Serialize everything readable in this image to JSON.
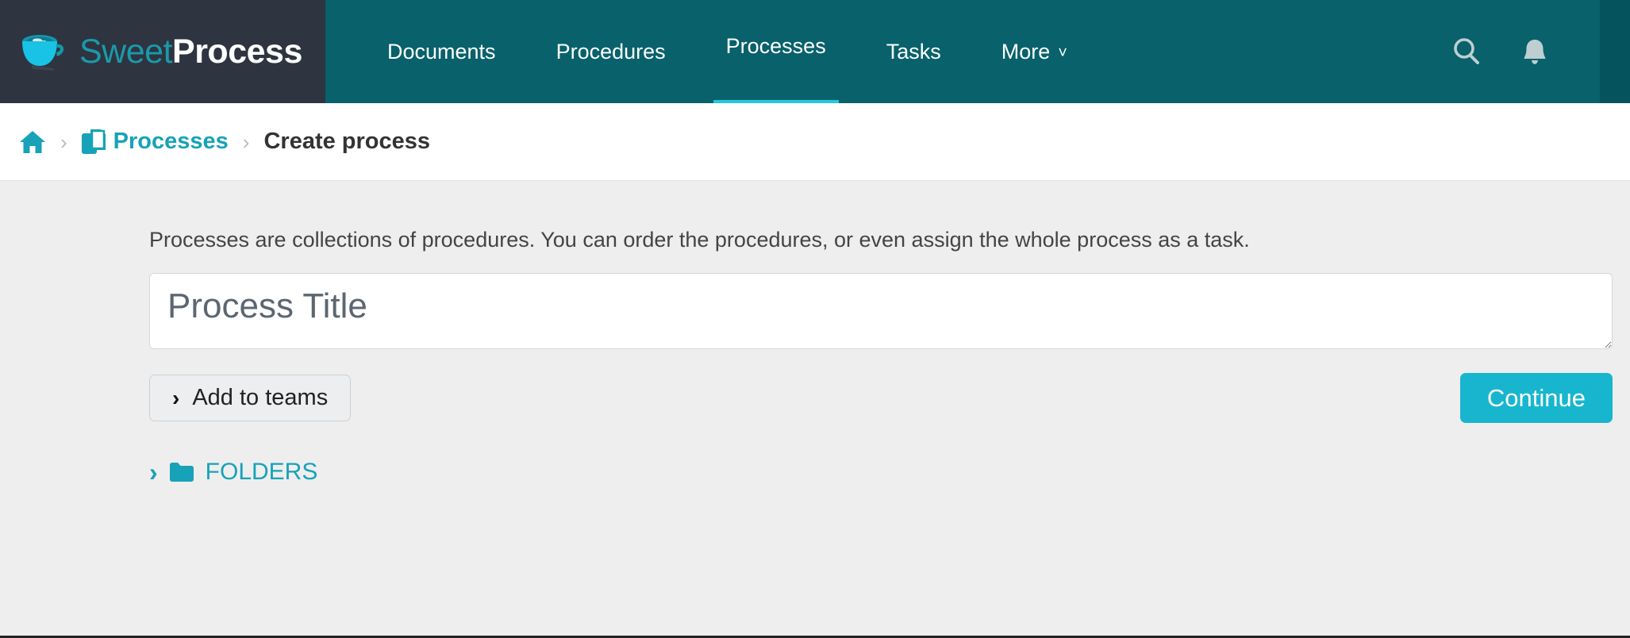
{
  "brand": {
    "name_part1": "Sweet",
    "name_part2": "Process",
    "logo_icon": "coffee-cup-icon",
    "dark_bg": "#2e3440",
    "teal_bg": "#08616b",
    "accent": "#25c8e0"
  },
  "nav": {
    "items": [
      {
        "label": "Documents",
        "active": false
      },
      {
        "label": "Procedures",
        "active": false
      },
      {
        "label": "Processes",
        "active": true
      },
      {
        "label": "Tasks",
        "active": false
      },
      {
        "label": "More",
        "active": false,
        "caret": "˅"
      }
    ],
    "icons": [
      {
        "name": "search-icon"
      },
      {
        "name": "notifications-bell-icon"
      }
    ]
  },
  "breadcrumb": {
    "home_icon": "home-icon",
    "separator": "›",
    "processes_icon": "copy-documents-icon",
    "processes_label": "Processes",
    "current_label": "Create process"
  },
  "main": {
    "intro": "Processes are collections of procedures. You can order the procedures, or even assign the whole process as a task.",
    "title_placeholder": "Process Title",
    "title_value": "",
    "add_to_teams_label": "Add to teams",
    "add_to_teams_chevron": "›",
    "continue_label": "Continue",
    "folders_chevron": "›",
    "folders_icon": "folder-icon",
    "folders_label": "FOLDERS",
    "link_color": "#17a2b8",
    "button_color": "#17b6ce"
  }
}
